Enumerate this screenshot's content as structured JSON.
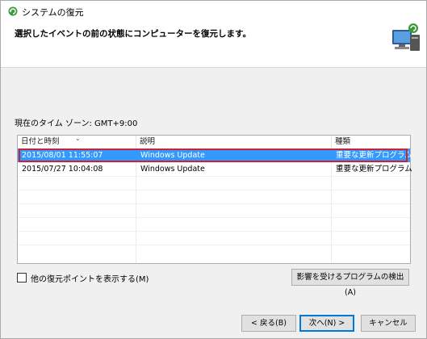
{
  "window": {
    "title": "システムの復元",
    "heading": "選択したイベントの前の状態にコンピューターを復元します。"
  },
  "timezone_label": "現在のタイム ゾーン: GMT+9:00",
  "table": {
    "columns": [
      "日付と時刻",
      "説明",
      "種類"
    ],
    "rows": [
      {
        "date": "2015/08/01 11:55:07",
        "desc": "Windows Update",
        "type": "重要な更新プログラム",
        "selected": true
      },
      {
        "date": "2015/07/27 10:04:08",
        "desc": "Windows Update",
        "type": "重要な更新プログラム",
        "selected": false
      }
    ]
  },
  "checkbox": {
    "label": "他の復元ポイントを表示する(M)",
    "checked": false
  },
  "buttons": {
    "scan": "影響を受けるプログラムの検出(A)",
    "back": "< 戻る(B)",
    "next": "次へ(N) >",
    "cancel": "キャンセル"
  },
  "colors": {
    "selection": "#3399ff",
    "highlight_outline": "#cc2233",
    "primary_border": "#0078d7"
  }
}
